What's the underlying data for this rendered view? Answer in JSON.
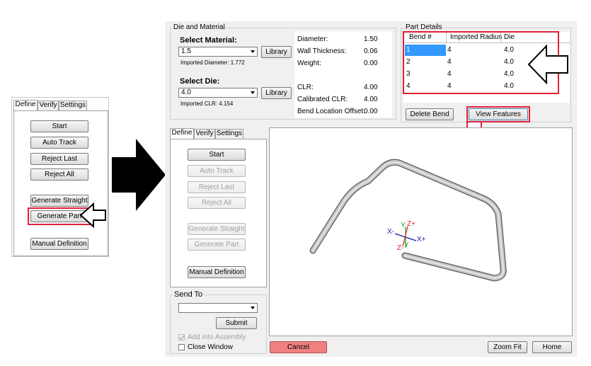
{
  "small_panel": {
    "tabs": [
      "Define",
      "Verify",
      "Settings"
    ],
    "buttons": {
      "start": "Start",
      "auto_track": "Auto Track",
      "reject_last": "Reject Last",
      "reject_all": "Reject All",
      "generate_straight": "Generate Straight",
      "generate_part": "Generate Part",
      "manual_definition": "Manual Definition"
    }
  },
  "die_material": {
    "title": "Die and Material",
    "select_material_label": "Select Material:",
    "material_value": "1.5",
    "library_label": "Library",
    "imported_diameter": "Imported Diameter: 1.772",
    "select_die_label": "Select Die:",
    "die_value": "4.0",
    "imported_clr": "Imported CLR: 4.154",
    "props": [
      {
        "label": "Diameter:",
        "value": "1.50"
      },
      {
        "label": "Wall Thickness:",
        "value": "0.06"
      },
      {
        "label": "Weight:",
        "value": "0.00"
      },
      {
        "label": "CLR:",
        "value": "4.00"
      },
      {
        "label": "Calibrated CLR:",
        "value": "4.00"
      },
      {
        "label": "Bend Location Offset:",
        "value": "0.00"
      }
    ]
  },
  "part_details": {
    "title": "Part Details",
    "columns": [
      "Bend #",
      "Imported Radius",
      "Die"
    ],
    "rows": [
      [
        "1",
        "4",
        "4.0"
      ],
      [
        "2",
        "4",
        "4.0"
      ],
      [
        "3",
        "4",
        "4.0"
      ],
      [
        "4",
        "4",
        "4.0"
      ]
    ],
    "delete_bend": "Delete Bend",
    "view_features": "View Features"
  },
  "main_panel": {
    "tabs": [
      "Define",
      "Verify",
      "Settings"
    ],
    "buttons": {
      "start": "Start",
      "auto_track": "Auto Track",
      "reject_last": "Reject Last",
      "reject_all": "Reject All",
      "generate_straight": "Generate Straight",
      "generate_part": "Generate Part",
      "manual_definition": "Manual Definition"
    }
  },
  "send_to": {
    "title": "Send To",
    "submit": "Submit",
    "add_into_assembly": "Add into Assembly",
    "close_window": "Close Window"
  },
  "viewport": {
    "axis_x_minus": "X-",
    "axis_x_plus": "X+",
    "axis_y": "Y",
    "axis_z_plus": "Z+",
    "axis_z_minus": "Z-",
    "axis_y_bottom": "Y"
  },
  "bottom_bar": {
    "cancel": "Cancel",
    "zoom_fit": "Zoom Fit",
    "home": "Home"
  },
  "colors": {
    "highlight_red": "#e0203a",
    "selection_blue": "#3399ff",
    "cancel_fill": "#f08080",
    "view_features_border": "#3c7fb1"
  }
}
